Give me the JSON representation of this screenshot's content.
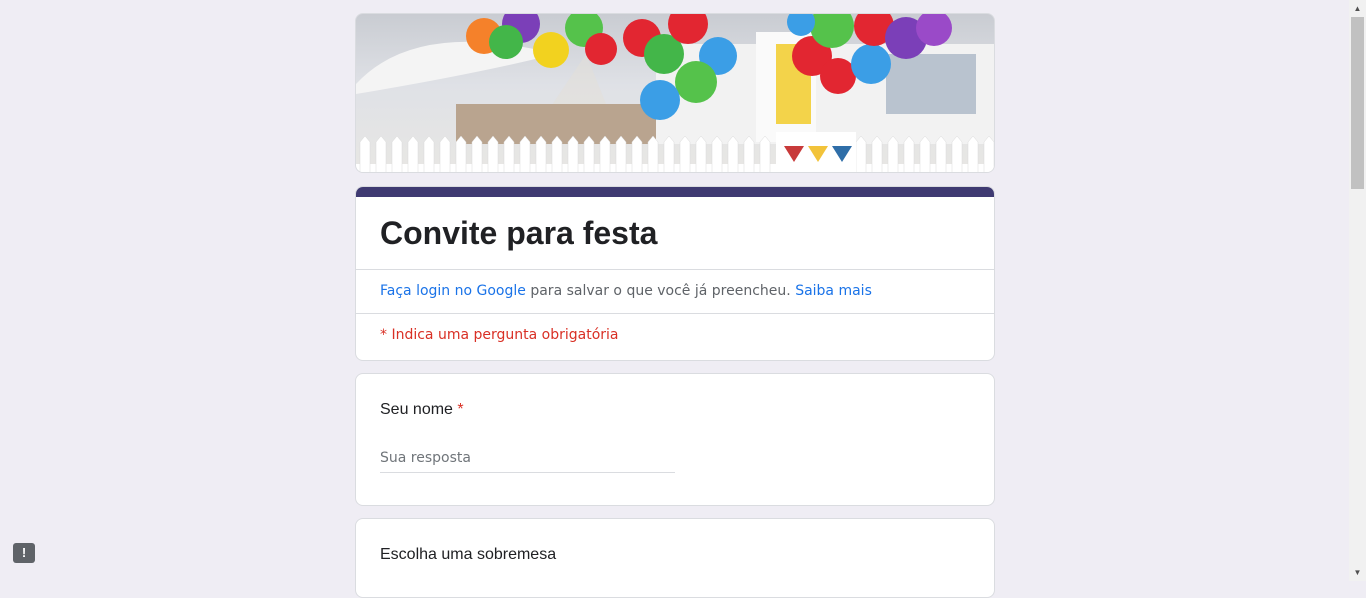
{
  "form": {
    "title": "Convite para festa",
    "login_link": "Faça login no Google",
    "login_text": " para salvar o que você já preencheu. ",
    "learn_more": "Saiba mais",
    "required_note": "* Indica uma pergunta obrigatória"
  },
  "questions": [
    {
      "title": "Seu nome",
      "required_mark": "*",
      "placeholder": "Sua resposta"
    },
    {
      "title": "Escolha uma sobremesa"
    }
  ],
  "colors": {
    "accent": "#3f3a72",
    "link": "#1a73e8",
    "required": "#d93025",
    "background": "#efedf4"
  },
  "icons": {
    "feedback": "report-icon"
  }
}
